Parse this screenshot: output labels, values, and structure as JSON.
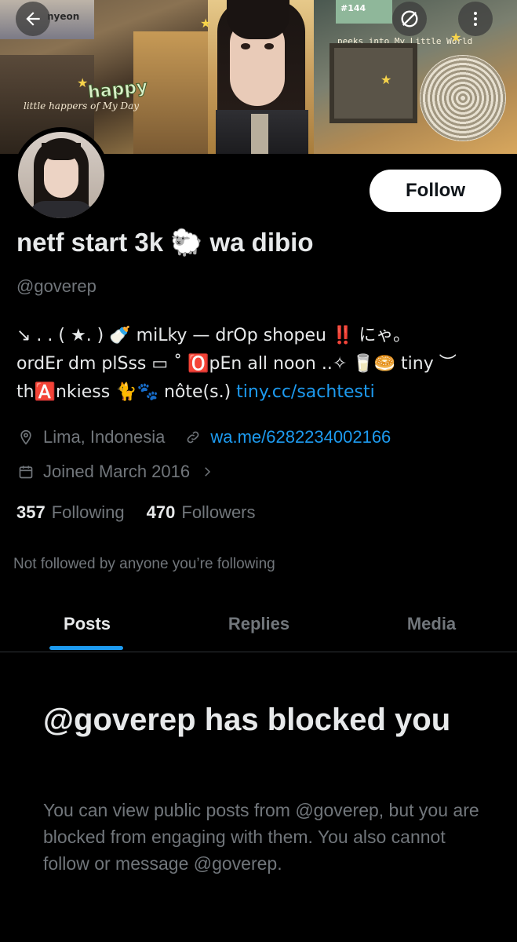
{
  "banner": {
    "sticker_text": "nyeon",
    "happy_text": "happy",
    "sub_text": "little happers of My Day",
    "blue_sticker_text": "#144",
    "peeks_text": "peeks into My Little World"
  },
  "header": {
    "back_icon": "arrow-left-icon",
    "block_icon": "blocked-icon",
    "more_icon": "more-vertical-icon"
  },
  "profile": {
    "follow_label": "Follow",
    "display_name": "netf start 3k 🐑 wa dibio",
    "handle": "@goverep",
    "bio": {
      "line1": "↘ . . ( ★. )  🍼 miLky — drOp shopeu ‼️ にゃ。",
      "line2": "ordEr dm plSss ▭  ˚ 🅾️pEn all noon ..✧ 🥛🥯 tiny ︶",
      "line3_text": "th🅰️nkiess  🐈🐾  nôte(s.) ",
      "line3_link": "tiny.cc/sachtesti"
    },
    "location": "Lima, Indonesia",
    "website": "wa.me/6282234002166",
    "joined": "Joined March 2016",
    "following_count": "357",
    "following_label": "Following",
    "followers_count": "470",
    "followers_label": "Followers",
    "not_followed": "Not followed by anyone you’re following"
  },
  "tabs": [
    {
      "label": "Posts",
      "active": true
    },
    {
      "label": "Replies",
      "active": false
    },
    {
      "label": "Media",
      "active": false
    }
  ],
  "blocked": {
    "title": "@goverep has blocked you",
    "description": "You can view public posts from @goverep, but you are blocked from engaging with them. You also cannot follow or message @goverep."
  },
  "colors": {
    "accent": "#1d9bf0",
    "background": "#000000",
    "text_primary": "#e7e9ea",
    "text_secondary": "#71767b"
  }
}
